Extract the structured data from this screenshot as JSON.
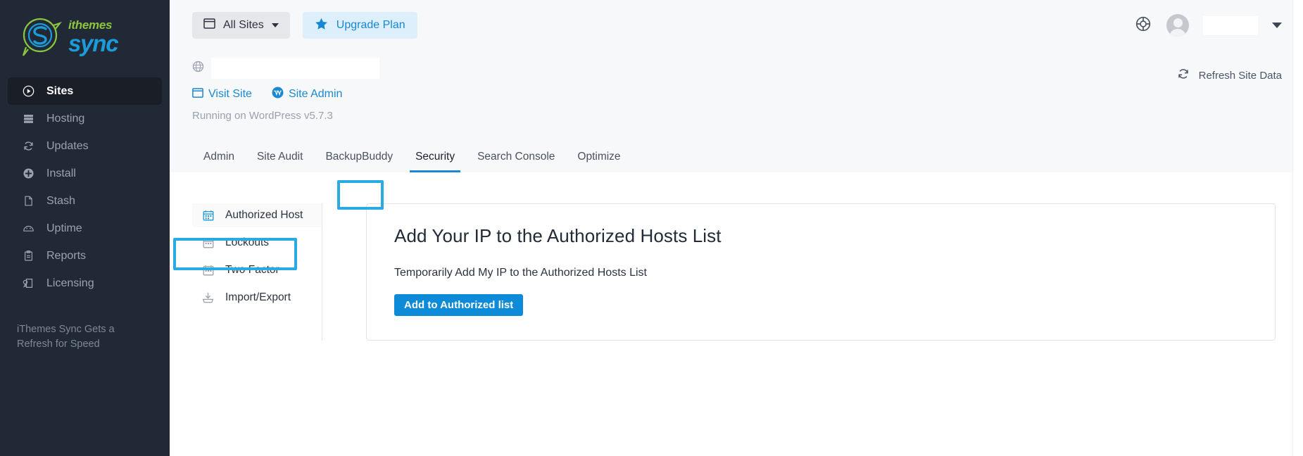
{
  "brand": {
    "top": "ithemes",
    "bottom": "sync",
    "logo_icon": "sync-s-logo-icon"
  },
  "sidebar": {
    "items": [
      {
        "label": "Sites",
        "icon": "play-circle-icon",
        "active": true
      },
      {
        "label": "Hosting",
        "icon": "server-icon",
        "active": false
      },
      {
        "label": "Updates",
        "icon": "refresh-icon",
        "active": false
      },
      {
        "label": "Install",
        "icon": "plus-circle-icon",
        "active": false
      },
      {
        "label": "Stash",
        "icon": "file-icon",
        "active": false
      },
      {
        "label": "Uptime",
        "icon": "gauge-icon",
        "active": false
      },
      {
        "label": "Reports",
        "icon": "clipboard-icon",
        "active": false
      },
      {
        "label": "Licensing",
        "icon": "license-tag-icon",
        "active": false
      }
    ],
    "note": "iThemes Sync Gets a Refresh for Speed"
  },
  "topbar": {
    "all_sites_label": "All Sites",
    "all_sites_icon": "window-icon",
    "upgrade_label": "Upgrade Plan",
    "upgrade_icon": "star-icon",
    "help_icon": "lifesaver-icon",
    "avatar_icon": "avatar",
    "user_name": "",
    "user_caret_icon": "chevron-down-icon"
  },
  "site": {
    "globe_icon": "globe-icon",
    "site_name": "",
    "visit_label": "Visit Site",
    "visit_icon": "window-icon",
    "admin_label": "Site Admin",
    "admin_icon": "wordpress-icon",
    "running_text": "Running on WordPress v5.7.3",
    "refresh_label": "Refresh Site Data",
    "refresh_icon": "refresh-icon"
  },
  "tabs": [
    {
      "label": "Admin",
      "active": false
    },
    {
      "label": "Site Audit",
      "active": false
    },
    {
      "label": "BackupBuddy",
      "active": false
    },
    {
      "label": "Security",
      "active": true
    },
    {
      "label": "Search Console",
      "active": false
    },
    {
      "label": "Optimize",
      "active": false
    }
  ],
  "submenu": [
    {
      "label": "Authorized Host",
      "icon": "calendar-icon",
      "active": true
    },
    {
      "label": "Lockouts",
      "icon": "calendar-icon",
      "active": false
    },
    {
      "label": "Two Factor",
      "icon": "calendar-icon",
      "active": false
    },
    {
      "label": "Import/Export",
      "icon": "import-export-icon",
      "active": false
    }
  ],
  "card": {
    "title": "Add Your IP to the Authorized Hosts List",
    "subtitle": "Temporarily Add My IP to the Authorized Hosts List",
    "button_label": "Add to Authorized list"
  },
  "colors": {
    "accent_blue": "#1b88d4",
    "button_blue": "#0d8bd9",
    "highlight_blue": "#29abe2",
    "sidebar_bg": "#222936",
    "brand_green": "#8cc63f"
  }
}
